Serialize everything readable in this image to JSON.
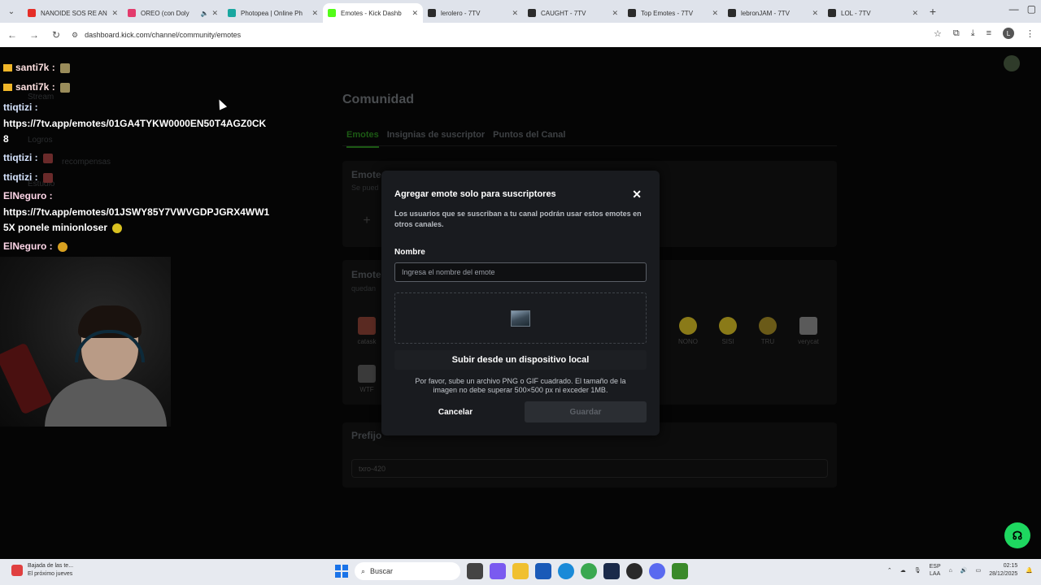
{
  "browser": {
    "tabs": [
      {
        "title": "NANOIDE SOS RE AN",
        "color": "#e52d27",
        "active": false
      },
      {
        "title": "OREO (con Doly",
        "color": "#e33b6c",
        "active": false,
        "audio": true
      },
      {
        "title": "Photopea | Online Ph",
        "color": "#19a7a0",
        "active": false
      },
      {
        "title": "Emotes - Kick Dashb",
        "color": "#53fc18",
        "active": true
      },
      {
        "title": "lerolero - 7TV",
        "color": "#2b2b2b",
        "active": false
      },
      {
        "title": "CAUGHT - 7TV",
        "color": "#2b2b2b",
        "active": false
      },
      {
        "title": "Top Emotes - 7TV",
        "color": "#2b2b2b",
        "active": false
      },
      {
        "title": "lebronJAM - 7TV",
        "color": "#2b2b2b",
        "active": false
      },
      {
        "title": "LOL - 7TV",
        "color": "#2b2b2b",
        "active": false
      }
    ],
    "url": "dashboard.kick.com/channel/community/emotes",
    "profile_initial": "L"
  },
  "chat": [
    {
      "user": "santi7k :",
      "msg": "",
      "badge": true,
      "kind": "santi"
    },
    {
      "user": "santi7k :",
      "msg": "",
      "badge": true,
      "kind": "santi"
    },
    {
      "user": "ttiqtizi :",
      "msg": "",
      "badge": false,
      "kind": "ttiq"
    },
    {
      "user": "",
      "msg": "https://7tv.app/emotes/01GA4TYKW0000EN50T4AGZ0CK",
      "badge": false,
      "kind": "msg"
    },
    {
      "user": "",
      "msg": "8",
      "badge": false,
      "kind": "msg"
    },
    {
      "user": "ttiqtizi :",
      "msg": "",
      "badge": false,
      "kind": "ttiq"
    },
    {
      "user": "ttiqtizi :",
      "msg": "",
      "badge": false,
      "kind": "ttiq"
    },
    {
      "user": "ElNeguro :",
      "msg": "",
      "badge": false,
      "kind": "eln"
    },
    {
      "user": "",
      "msg": "https://7tv.app/emotes/01JSWY85Y7VWVGDPJGRX4WW1",
      "badge": false,
      "kind": "msg"
    },
    {
      "user": "",
      "msg": "5X ponele minionloser",
      "badge": false,
      "kind": "msg"
    },
    {
      "user": "ElNeguro :",
      "msg": "",
      "badge": false,
      "kind": "eln"
    }
  ],
  "dashboard": {
    "title": "Comunidad",
    "tabs": [
      "Emotes",
      "Insignias de suscriptor",
      "Puntos del Canal"
    ],
    "section1_title": "Emote",
    "section1_sub": "Se pued",
    "section2_title": "Emote",
    "section2_sub": "quedan",
    "emotes": [
      {
        "name": "catask",
        "color": "#5a2a22"
      },
      {
        "name": "WTF",
        "color": "#3a3a3a"
      },
      {
        "name": "NONO",
        "color": "#8a7a18"
      },
      {
        "name": "SISI",
        "color": "#8a7a18"
      },
      {
        "name": "TRU",
        "color": "#6a5a18"
      },
      {
        "name": "verycat",
        "color": "#5a5a5a"
      }
    ],
    "prefix_title": "Prefijo",
    "prefix_value": "txro-420",
    "sidebar": [
      "Stream",
      "Logros",
      "recompensas",
      "Estudio"
    ]
  },
  "modal": {
    "title": "Agregar emote solo para suscriptores",
    "description": "Los usuarios que se suscriban a tu canal podrán usar estos emotes en otros canales.",
    "name_label": "Nombre",
    "name_placeholder": "Ingresa el nombre del emote",
    "upload_label": "Subir desde un dispositivo local",
    "note": "Por favor, sube un archivo PNG o GIF cuadrado. El tamaño de la imagen no debe superar 500×500 px ni exceder 1MB.",
    "cancel_label": "Cancelar",
    "save_label": "Guardar"
  },
  "taskbar": {
    "news_line1": "Bajada de las te...",
    "news_line2": "El próximo jueves",
    "search_placeholder": "Buscar",
    "lang1": "ESP",
    "lang2": "LAA",
    "time": "02:15",
    "date": "28/12/2025"
  },
  "colors": {
    "kick_green": "#53fc18",
    "modal_bg": "#191b1f",
    "help_button": "#1ed760"
  }
}
